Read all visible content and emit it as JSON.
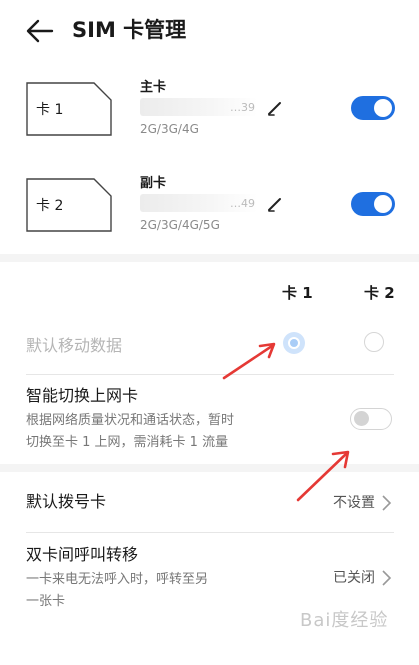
{
  "header": {
    "title": "SIM 卡管理"
  },
  "sims": [
    {
      "card_label": "卡 1",
      "name": "主卡",
      "number_tail": "…39",
      "network": "2G/3G/4G",
      "enabled": true
    },
    {
      "card_label": "卡 2",
      "name": "副卡",
      "number_tail": "…49",
      "network": "2G/3G/4G/5G",
      "enabled": true
    }
  ],
  "data_settings": {
    "columns": [
      "卡 1",
      "卡 2"
    ],
    "default_mobile_data": {
      "label": "默认移动数据",
      "selected": "卡 1"
    },
    "smart_switch": {
      "label": "智能切换上网卡",
      "description_line1": "根据网络质量状况和通话状态，暂时",
      "description_line2": "切换至卡 1 上网，需消耗卡 1 流量",
      "enabled": false
    }
  },
  "call_settings": {
    "default_dial": {
      "label": "默认拨号卡",
      "value": "不设置"
    },
    "call_forward": {
      "label": "双卡间呼叫转移",
      "description_line1": "一卡来电无法呼入时，呼转至另",
      "description_line2": "一张卡",
      "value": "已关闭"
    }
  },
  "colors": {
    "accent": "#1f6fe0",
    "annotation_arrow": "#e53935"
  },
  "watermark": "Bai度经验"
}
